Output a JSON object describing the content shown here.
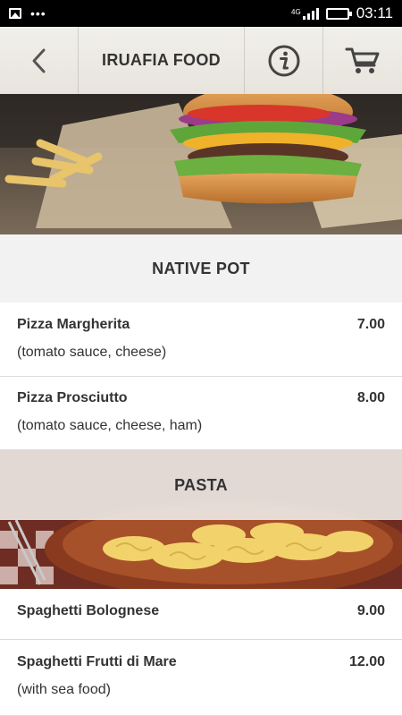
{
  "status_bar": {
    "network": "4G",
    "time": "03:11",
    "icons": [
      "image-icon",
      "more-dots-icon",
      "signal-icon",
      "battery-icon"
    ]
  },
  "header": {
    "title": "IRUAFIA FOOD",
    "icons": [
      "back-chevron-icon",
      "info-icon",
      "cart-icon"
    ]
  },
  "sections": [
    {
      "title": "NATIVE POT",
      "items": [
        {
          "name": "Pizza Margherita",
          "price": "7.00",
          "desc": "(tomato sauce, cheese)"
        },
        {
          "name": "Pizza Prosciutto",
          "price": "8.00",
          "desc": "(tomato sauce, cheese, ham)"
        }
      ]
    },
    {
      "title": "PASTA",
      "items": [
        {
          "name": "Spaghetti Bolognese",
          "price": "9.00",
          "desc": ""
        },
        {
          "name": "Spaghetti Frutti di Mare",
          "price": "12.00",
          "desc": "(with sea food)"
        }
      ]
    }
  ],
  "colors": {
    "status_bar": "#000000",
    "header_bg": "#eeebe6",
    "section_bg": "#f2f2f2",
    "text": "#333333",
    "divider": "#dcdcdc"
  }
}
